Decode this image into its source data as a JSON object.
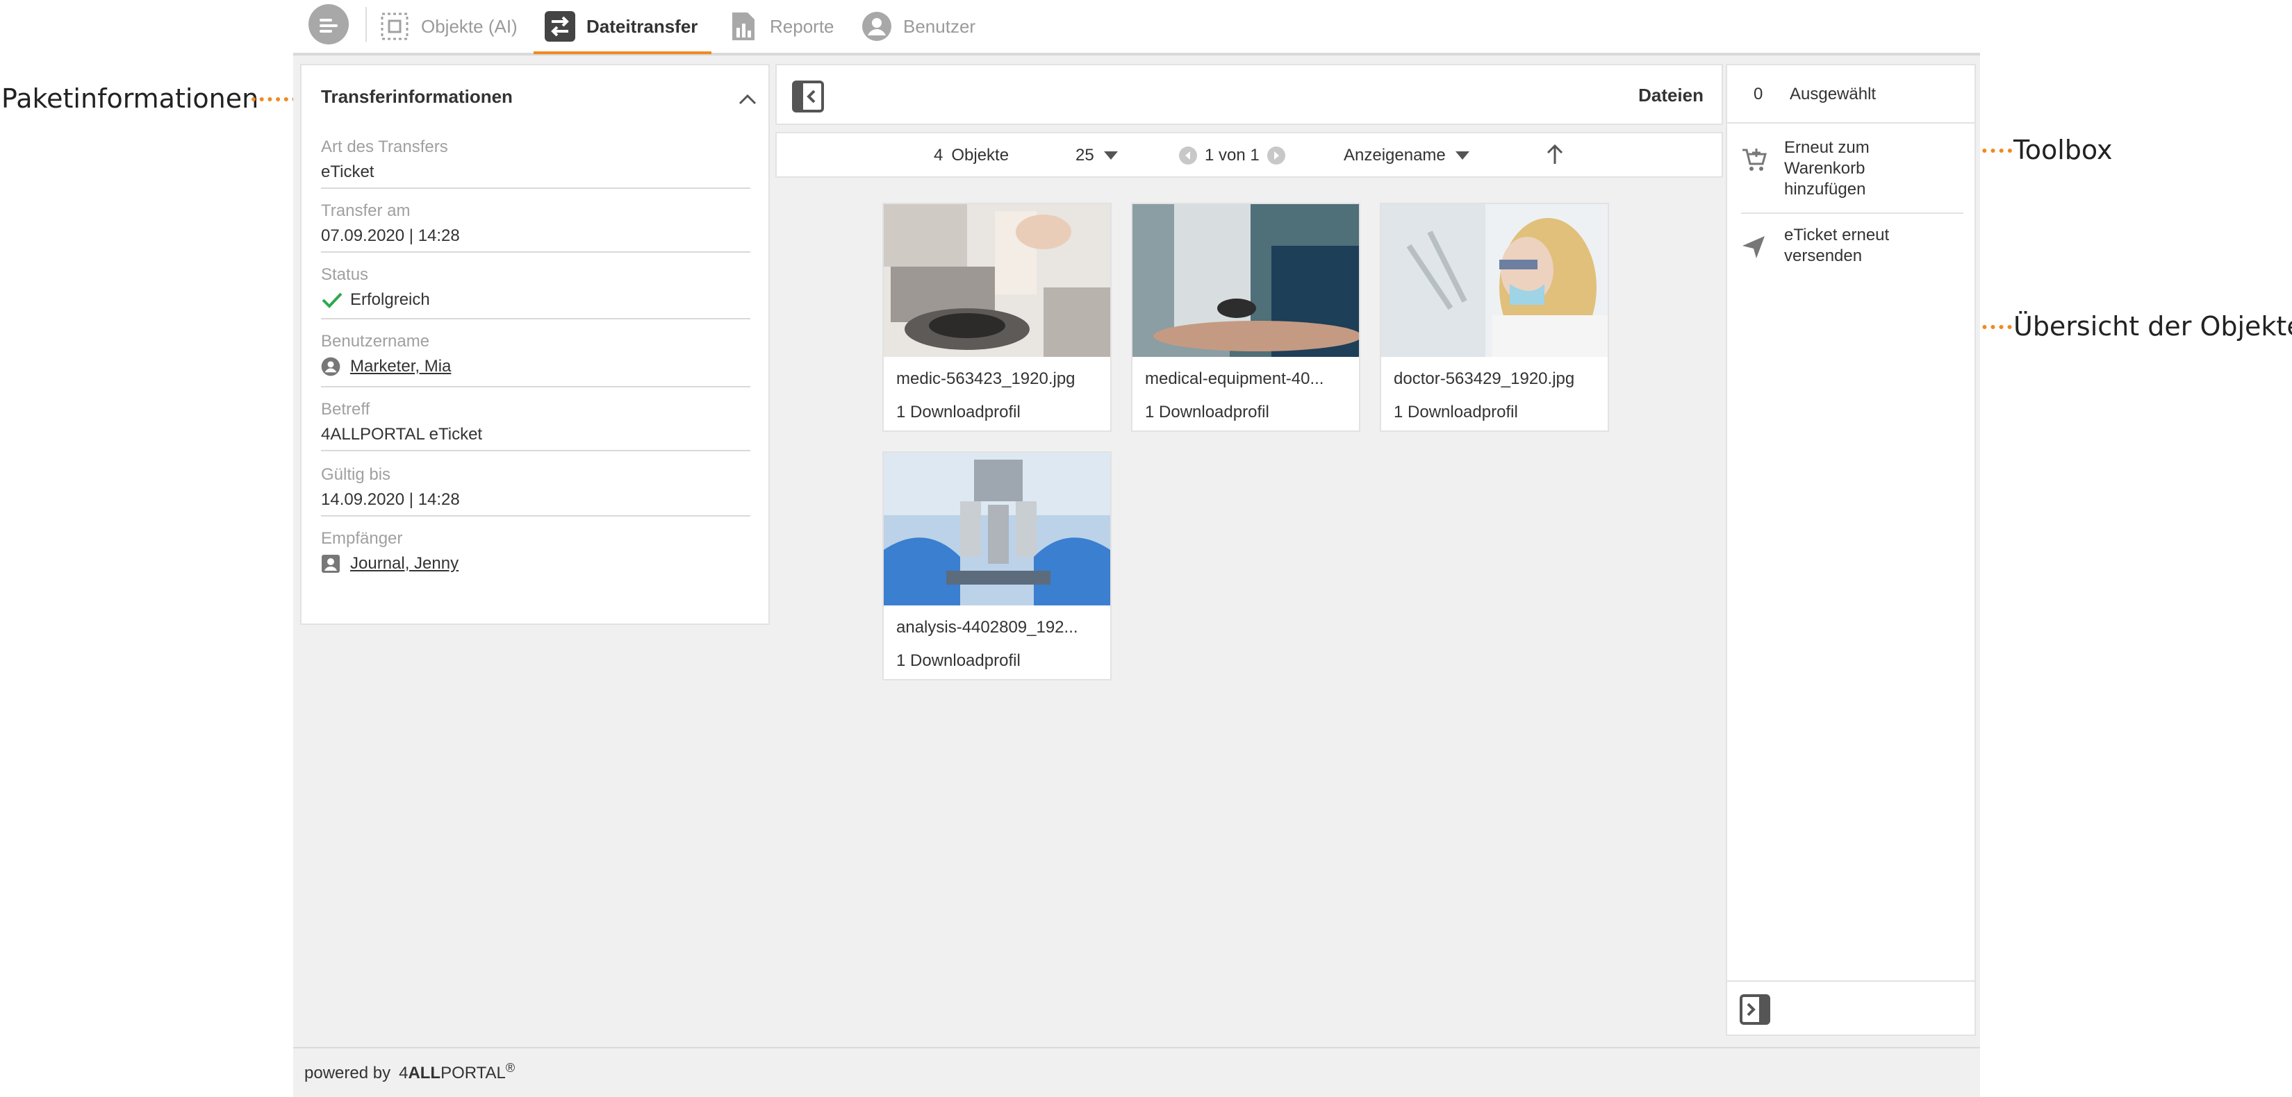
{
  "annotations": {
    "package_info": "Paketinformationen",
    "toolbox": "Toolbox",
    "objects_overview": "Übersicht der Objekte"
  },
  "nav": {
    "items": [
      {
        "label": "Objekte (AI)",
        "icon": "objects-frame-icon"
      },
      {
        "label": "Dateitransfer",
        "icon": "transfer-arrows-icon"
      },
      {
        "label": "Reporte",
        "icon": "report-icon"
      },
      {
        "label": "Benutzer",
        "icon": "user-circle-icon"
      }
    ],
    "active": "Dateitransfer"
  },
  "transfer": {
    "title": "Transferinformationen",
    "fields": [
      {
        "label": "Art des Transfers",
        "value": "eTicket"
      },
      {
        "label": "Transfer am",
        "value": "07.09.2020 | 14:28"
      },
      {
        "label": "Status",
        "value": "Erfolgreich"
      },
      {
        "label": "Benutzername",
        "value": "Marketer, Mia"
      },
      {
        "label": "Betreff",
        "value": "4ALLPORTAL eTicket"
      },
      {
        "label": "Gültig bis",
        "value": "14.09.2020 | 14:28"
      },
      {
        "label": "Empfänger",
        "value": "Journal, Jenny"
      }
    ]
  },
  "files": {
    "title": "Dateien",
    "count": "4",
    "count_label": "Objekte",
    "per_page": "25",
    "page_text": "1 von 1",
    "sort": "Anzeigename",
    "items": [
      {
        "name": "medic-563423_1920.jpg",
        "profiles": "1 Downloadprofil"
      },
      {
        "name": "medical-equipment-40...",
        "profiles": "1 Downloadprofil"
      },
      {
        "name": "doctor-563429_1920.jpg",
        "profiles": "1 Downloadprofil"
      },
      {
        "name": "analysis-4402809_192...",
        "profiles": "1 Downloadprofil"
      }
    ]
  },
  "toolbox": {
    "selected_count": "0",
    "selected_label": "Ausgewählt",
    "tools": [
      {
        "label": "Erneut zum Warenkorb hinzufügen",
        "icon": "cart-add-icon"
      },
      {
        "label": "eTicket erneut versenden",
        "icon": "send-icon"
      }
    ]
  },
  "footer": {
    "powered_by": "powered by",
    "brand_prefix": "4",
    "brand_bold": "ALL",
    "brand_suffix": "PORTAL",
    "brand_mark": "®"
  },
  "colors": {
    "accent": "#f08a1e",
    "success": "#2fa84f",
    "background": "#f0f0f0"
  }
}
